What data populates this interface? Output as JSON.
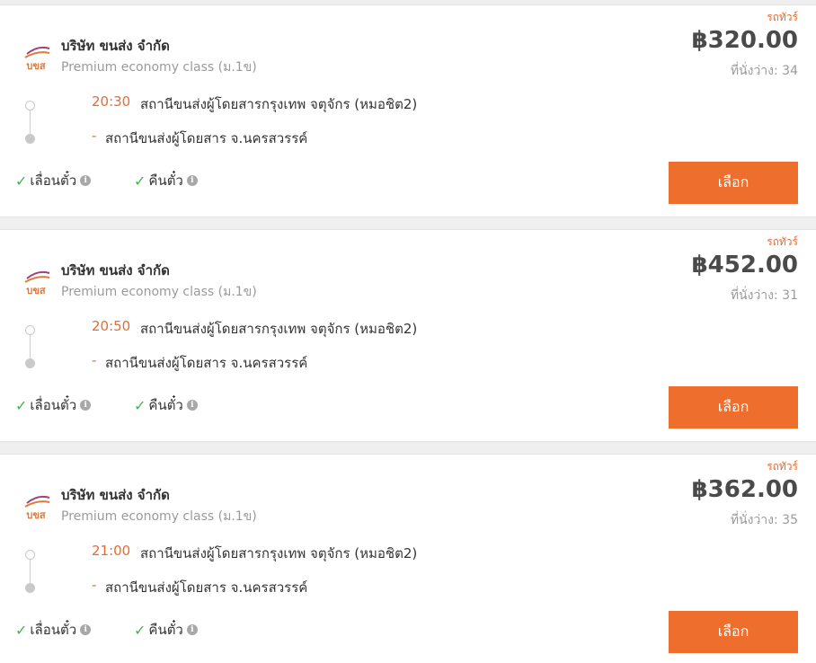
{
  "select_label": "เลือก",
  "colors": {
    "accent": "#ed6e2d",
    "time": "#ea6a2f",
    "check": "#4caf50",
    "logo_stripe": "#a0407a"
  },
  "trips": [
    {
      "type_label": "รถทัวร์",
      "operator": "บริษัท ขนส่ง จำกัด",
      "bus_class": "Premium economy class (ม.1ข)",
      "logo_text": "บขส",
      "price": "฿320.00",
      "seats": "ที่นั่งว่าง: 34",
      "dep_time": "20:30",
      "dep_station": "สถานีขนส่งผู้โดยสารกรุงเทพ จตุจักร (หมอชิต2)",
      "arr_time": "-",
      "arr_station": "สถานีขนส่งผู้โดยสาร จ.นครสวรรค์",
      "feature_1": "เลื่อนตั๋ว",
      "feature_2": "คืนตั๋ว"
    },
    {
      "type_label": "รถทัวร์",
      "operator": "บริษัท ขนส่ง จำกัด",
      "bus_class": "Premium economy class (ม.1ข)",
      "logo_text": "บขส",
      "price": "฿452.00",
      "seats": "ที่นั่งว่าง: 31",
      "dep_time": "20:50",
      "dep_station": "สถานีขนส่งผู้โดยสารกรุงเทพ จตุจักร (หมอชิต2)",
      "arr_time": "-",
      "arr_station": "สถานีขนส่งผู้โดยสาร จ.นครสวรรค์",
      "feature_1": "เลื่อนตั๋ว",
      "feature_2": "คืนตั๋ว"
    },
    {
      "type_label": "รถทัวร์",
      "operator": "บริษัท ขนส่ง จำกัด",
      "bus_class": "Premium economy class (ม.1ข)",
      "logo_text": "บขส",
      "price": "฿362.00",
      "seats": "ที่นั่งว่าง: 35",
      "dep_time": "21:00",
      "dep_station": "สถานีขนส่งผู้โดยสารกรุงเทพ จตุจักร (หมอชิต2)",
      "arr_time": "-",
      "arr_station": "สถานีขนส่งผู้โดยสาร จ.นครสวรรค์",
      "feature_1": "เลื่อนตั๋ว",
      "feature_2": "คืนตั๋ว"
    }
  ]
}
